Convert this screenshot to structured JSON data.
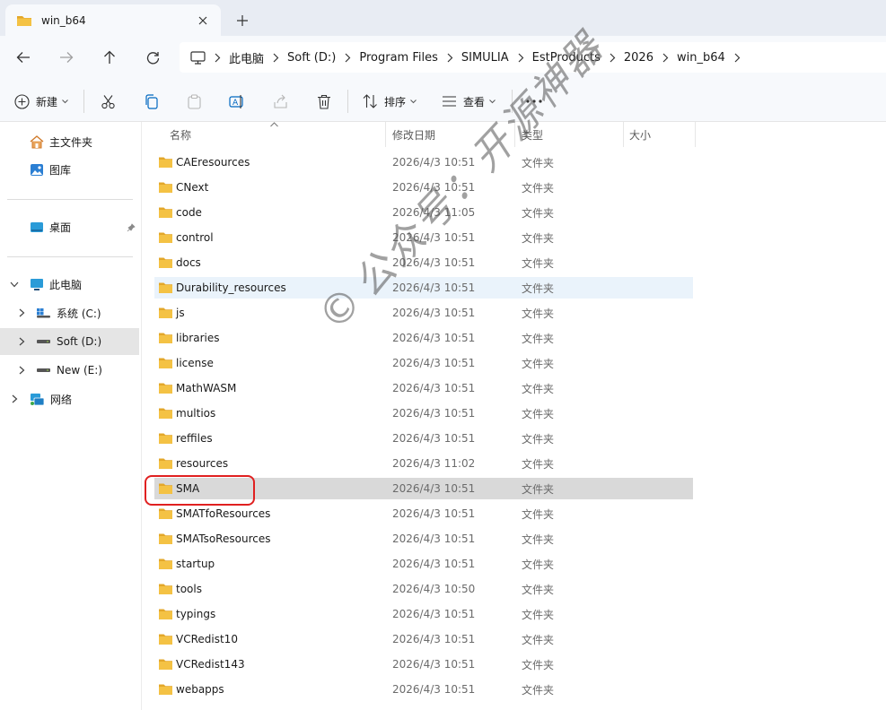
{
  "tab": {
    "title": "win_b64"
  },
  "breadcrumb": [
    "此电脑",
    "Soft (D:)",
    "Program Files",
    "SIMULIA",
    "EstProducts",
    "2026",
    "win_b64"
  ],
  "toolbar": {
    "new_label": "新建",
    "sort_label": "排序",
    "view_label": "查看"
  },
  "sidebar": {
    "home": "主文件夹",
    "gallery": "图库",
    "desktop": "桌面",
    "this_pc": "此电脑",
    "drive_c": "系统 (C:)",
    "drive_d": "Soft (D:)",
    "drive_e": "New (E:)",
    "network": "网络"
  },
  "columns": {
    "name": "名称",
    "date": "修改日期",
    "type": "类型",
    "size": "大小"
  },
  "files": [
    {
      "name": "CAEresources",
      "date": "2026/4/3 10:51",
      "type": "文件夹"
    },
    {
      "name": "CNext",
      "date": "2026/4/3 10:51",
      "type": "文件夹"
    },
    {
      "name": "code",
      "date": "2026/4/3 11:05",
      "type": "文件夹"
    },
    {
      "name": "control",
      "date": "2026/4/3 10:51",
      "type": "文件夹"
    },
    {
      "name": "docs",
      "date": "2026/4/3 10:51",
      "type": "文件夹"
    },
    {
      "name": "Durability_resources",
      "date": "2026/4/3 10:51",
      "type": "文件夹"
    },
    {
      "name": "js",
      "date": "2026/4/3 10:51",
      "type": "文件夹"
    },
    {
      "name": "libraries",
      "date": "2026/4/3 10:51",
      "type": "文件夹"
    },
    {
      "name": "license",
      "date": "2026/4/3 10:51",
      "type": "文件夹"
    },
    {
      "name": "MathWASM",
      "date": "2026/4/3 10:51",
      "type": "文件夹"
    },
    {
      "name": "multios",
      "date": "2026/4/3 10:51",
      "type": "文件夹"
    },
    {
      "name": "reffiles",
      "date": "2026/4/3 10:51",
      "type": "文件夹"
    },
    {
      "name": "resources",
      "date": "2026/4/3 11:02",
      "type": "文件夹"
    },
    {
      "name": "SMA",
      "date": "2026/4/3 10:51",
      "type": "文件夹"
    },
    {
      "name": "SMATfoResources",
      "date": "2026/4/3 10:51",
      "type": "文件夹"
    },
    {
      "name": "SMATsoResources",
      "date": "2026/4/3 10:51",
      "type": "文件夹"
    },
    {
      "name": "startup",
      "date": "2026/4/3 10:51",
      "type": "文件夹"
    },
    {
      "name": "tools",
      "date": "2026/4/3 10:50",
      "type": "文件夹"
    },
    {
      "name": "typings",
      "date": "2026/4/3 10:51",
      "type": "文件夹"
    },
    {
      "name": "VCRedist10",
      "date": "2026/4/3 10:51",
      "type": "文件夹"
    },
    {
      "name": "VCRedist143",
      "date": "2026/4/3 10:51",
      "type": "文件夹"
    },
    {
      "name": "webapps",
      "date": "2026/4/3 10:51",
      "type": "文件夹"
    }
  ],
  "colors": {
    "folder": "#f4c244",
    "folder_back": "#e3a72a",
    "accent": "#0067c0",
    "highlight_ring": "#e02020",
    "selected_row": "#d9d9d9",
    "hover_row": "#eaf3fb"
  },
  "icons": [
    "folder-icon",
    "close-icon",
    "plus-icon",
    "back-arrow-icon",
    "forward-arrow-icon",
    "up-arrow-icon",
    "refresh-icon",
    "monitor-icon",
    "chevron-right-icon",
    "cut-icon",
    "copy-icon",
    "paste-icon",
    "rename-icon",
    "share-icon",
    "delete-icon",
    "sort-icon",
    "view-icon",
    "more-icon",
    "home-icon",
    "gallery-icon",
    "desktop-icon",
    "pin-icon",
    "drive-icon",
    "network-icon"
  ]
}
